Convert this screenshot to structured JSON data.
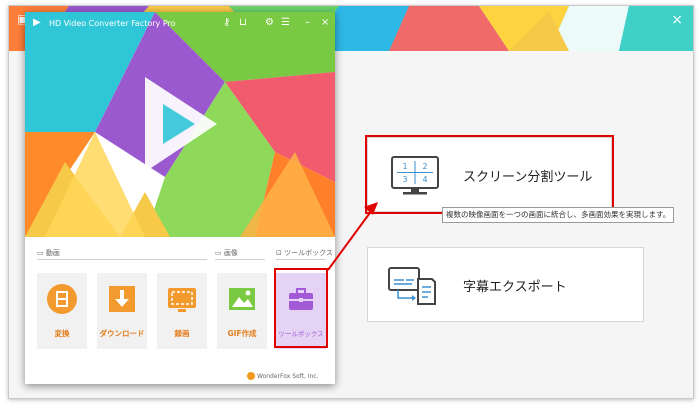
{
  "app": {
    "title": "HD Video Converter Factory Pro",
    "brand_footer": "WonderFox Soft, Inc.",
    "sections": {
      "video": "動画",
      "image": "画像",
      "toolbox": "ツールボックス"
    },
    "tiles": [
      {
        "label": "変換",
        "icon": "film-icon"
      },
      {
        "label": "ダウンロード",
        "icon": "download-icon"
      },
      {
        "label": "録画",
        "icon": "screen-record-icon"
      },
      {
        "label": "GIF作成",
        "icon": "gif-image-icon"
      },
      {
        "label": "ツールボックス",
        "icon": "toolbox-icon"
      }
    ]
  },
  "toolbox_window": {
    "close": "×",
    "tools": [
      {
        "label": "スクリーン分割ツール",
        "icon": "split-screen-icon",
        "split_cells": [
          "1",
          "2",
          "3",
          "4"
        ]
      },
      {
        "label": "字幕エクスポート",
        "icon": "subtitle-export-icon"
      }
    ],
    "tooltip": "複数の映像画面を一つの画面に統合し、多画面効果を実現します。"
  },
  "colors": {
    "highlight": "#e10000",
    "tile_text": "#e37d1b",
    "toolbox_tile_bg": "#e4d3f4",
    "toolbox_tile_text": "#a35ad6"
  }
}
